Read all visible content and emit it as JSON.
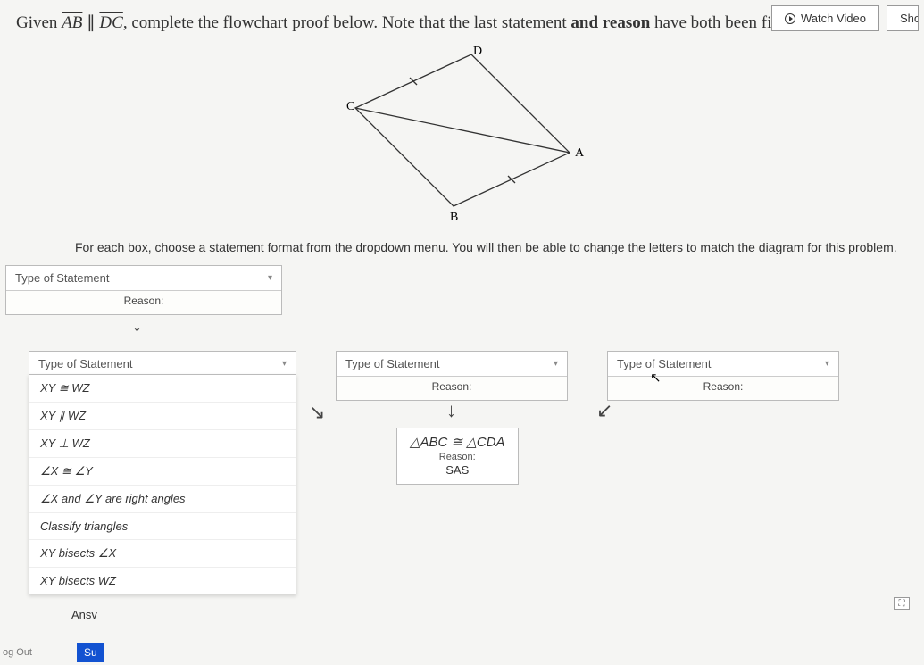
{
  "top": {
    "watch_video": "Watch Video",
    "show_partial": "Sho"
  },
  "prompt": {
    "given": "Given ",
    "seg1": "AB",
    "parallel": " ∥ ",
    "seg2": "DC",
    "rest": ", complete the flowchart proof below. Note that the last statement ",
    "bold1": "and reason",
    "rest2": " have both been filled in for you."
  },
  "figure_labels": {
    "A": "A",
    "B": "B",
    "C": "C",
    "D": "D"
  },
  "instruction": "For each box, choose a statement format from the dropdown menu. You will then be able to change the letters to match the diagram for this problem.",
  "flow": {
    "top_select": "Type of Statement",
    "reason_label": "Reason:",
    "col1_select": "Type of Statement",
    "col2_select": "Type of Statement",
    "col3_select": "Type of Statement"
  },
  "dropdown": {
    "opt1": "XY ≅ WZ",
    "opt2": "XY ∥ WZ",
    "opt3": "XY ⊥ WZ",
    "opt4": "∠X ≅ ∠Y",
    "opt5": "∠X and ∠Y are right angles",
    "opt6": "Classify triangles",
    "opt7": "XY bisects ∠X",
    "opt8": "XY bisects WZ"
  },
  "final": {
    "stmt": "△ABC ≅ △CDA",
    "label": "Reason:",
    "value": "SAS"
  },
  "footer": {
    "answ": "Ansv",
    "submit": "Su",
    "logout": "og Out"
  }
}
